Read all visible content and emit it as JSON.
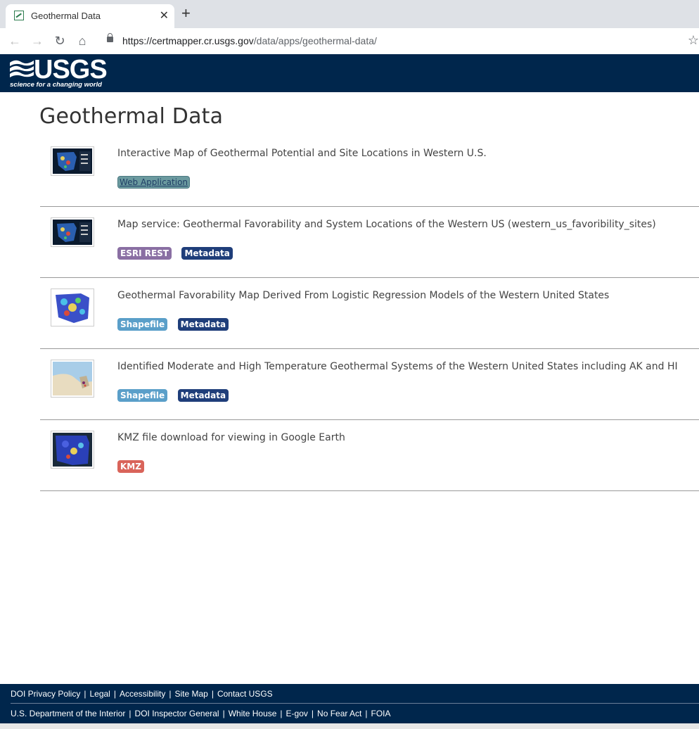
{
  "browser": {
    "tab_title": "Geothermal Data",
    "url_host": "https://certmapper.cr.usgs.gov",
    "url_path": "/data/apps/geothermal-data/"
  },
  "header": {
    "logo_text": "USGS",
    "tagline": "science for a changing world"
  },
  "page": {
    "title": "Geothermal Data"
  },
  "items": [
    {
      "title": "Interactive Map of Geothermal Potential and Site Locations in Western U.S.",
      "badges": [
        "Web Application"
      ]
    },
    {
      "title": "Map service: Geothermal Favorability and System Locations of the Western US (western_us_favoribility_sites)",
      "badges": [
        "ESRI REST",
        "Metadata"
      ]
    },
    {
      "title": "Geothermal Favorability Map Derived From Logistic Regression Models of the Western United States",
      "badges": [
        "Shapefile",
        "Metadata"
      ]
    },
    {
      "title": "Identified Moderate and High Temperature Geothermal Systems of the Western United States including AK and HI",
      "badges": [
        "Shapefile",
        "Metadata"
      ]
    },
    {
      "title": "KMZ file download for viewing in Google Earth",
      "badges": [
        "KMZ"
      ]
    }
  ],
  "footer": {
    "line1": [
      "DOI Privacy Policy",
      "Legal",
      "Accessibility",
      "Site Map",
      "Contact USGS"
    ],
    "line2": [
      "U.S. Department of the Interior",
      "DOI Inspector General",
      "White House",
      "E-gov",
      "No Fear Act",
      "FOIA"
    ],
    "separator": "|"
  },
  "colors": {
    "header_bg": "#00264c",
    "badge_esri": "#8a6fa3",
    "badge_metadata": "#1f3e7a",
    "badge_shapefile": "#5a9fc9",
    "badge_kmz": "#d9645a",
    "badge_webapp": "#6b9a9f"
  }
}
